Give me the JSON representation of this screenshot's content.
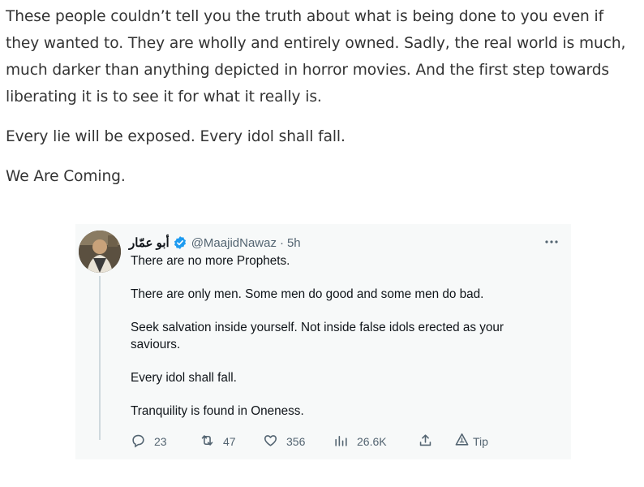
{
  "post": {
    "paragraphs": [
      "These people couldn’t tell you the truth about what is being done to you even if they wanted to. They are wholly and entirely owned. Sadly, the real world is much, much darker than anything depicted in horror movies. And the first step towards liberating it is to see it for what it really is.",
      "Every lie will be exposed. Every idol shall fall.",
      "We Are Coming."
    ]
  },
  "quoted_tweet": {
    "display_name": "أبو عمّار",
    "handle": "@MaajidNawaz",
    "separator": "·",
    "time": "5h",
    "lines": [
      "There are no more Prophets.",
      "There are only men. Some men do good and some men do bad.",
      "Seek salvation inside yourself. Not inside false idols erected as your saviours.",
      "Every idol shall fall.",
      "Tranquility is found in Oneness."
    ],
    "actions": {
      "replies": "23",
      "retweets": "47",
      "likes": "356",
      "views": "26.6K",
      "tip_label": "Tip"
    },
    "icons": {
      "reply": "reply-icon",
      "retweet": "retweet-icon",
      "like": "heart-icon",
      "views": "views-icon",
      "share": "share-icon",
      "tip": "tip-icon",
      "more": "more-icon",
      "verified": "verified-badge-icon"
    },
    "colors": {
      "card_background": "#f7f9f9",
      "verified_blue": "#1d9bf0",
      "secondary_text": "#536471",
      "primary_text": "#0f1419"
    }
  }
}
